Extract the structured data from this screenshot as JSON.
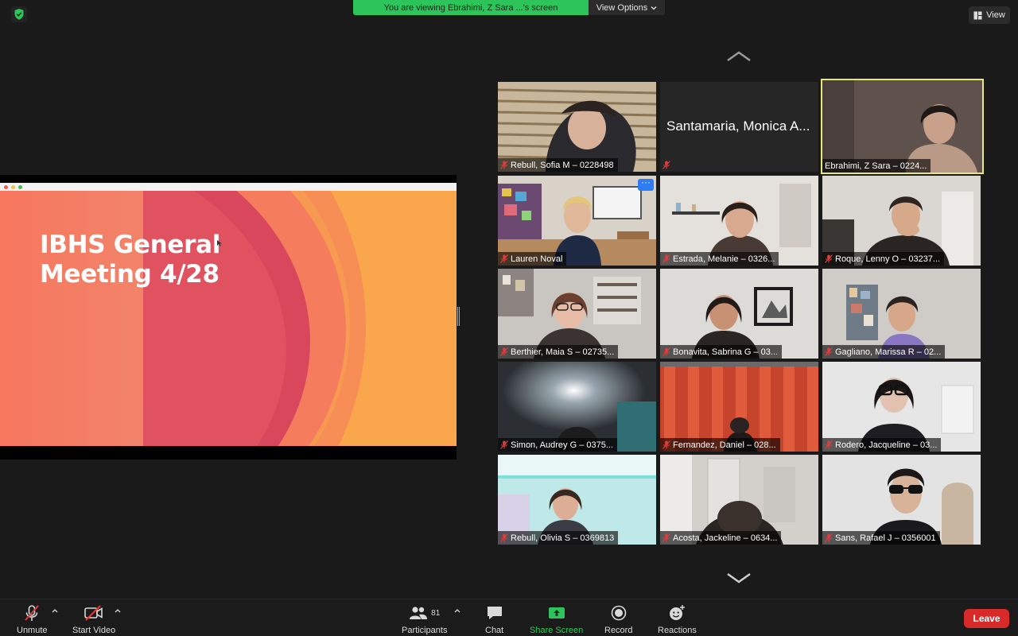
{
  "banner": {
    "viewing_text": "You are viewing Ebrahimi, Z Sara ...'s screen",
    "view_options_label": "View Options"
  },
  "view_button_label": "View",
  "slide": {
    "title_line1": "IBHS General",
    "title_line2": "Meeting 4/28"
  },
  "participants": [
    {
      "name": "Rebull, Sofia M – 0228498"
    },
    {
      "name": "Santamaria, Monica A...",
      "video_off": true
    },
    {
      "name": "Ebrahimi, Z Sara – 0224...",
      "active_speaker": true
    },
    {
      "name": "Lauren Noval"
    },
    {
      "name": "Estrada, Melanie – 0326..."
    },
    {
      "name": "Roque, Lenny O – 03237..."
    },
    {
      "name": "Berthier, Maia S – 02735..."
    },
    {
      "name": "Bonavita, Sabrina G – 03..."
    },
    {
      "name": "Gagliano, Marissa R – 02..."
    },
    {
      "name": "Simon, Audrey G – 0375..."
    },
    {
      "name": "Fernandez, Daniel – 028..."
    },
    {
      "name": "Rodero, Jacqueline – 03..."
    },
    {
      "name": "Rebull, Olivia S – 0369813"
    },
    {
      "name": "Acosta, Jackeline – 0634..."
    },
    {
      "name": "Sans, Rafael J – 0356001"
    }
  ],
  "toolbar": {
    "unmute_label": "Unmute",
    "start_video_label": "Start Video",
    "participants_label": "Participants",
    "participants_count": "81",
    "chat_label": "Chat",
    "share_screen_label": "Share Screen",
    "record_label": "Record",
    "reactions_label": "Reactions",
    "leave_label": "Leave"
  },
  "colors": {
    "share_green": "#2dc55b",
    "leave_red": "#d92a2a",
    "active_outline": "#e4e97a",
    "slide_orange": "#f79a4e",
    "slide_crimson": "#d4435a"
  },
  "icons": [
    "shield-check-icon",
    "grid-view-icon",
    "chevron-up-icon",
    "chevron-down-icon",
    "mic-muted-icon",
    "video-muted-icon",
    "participants-icon",
    "chat-icon",
    "share-screen-icon",
    "record-icon",
    "reactions-icon"
  ]
}
